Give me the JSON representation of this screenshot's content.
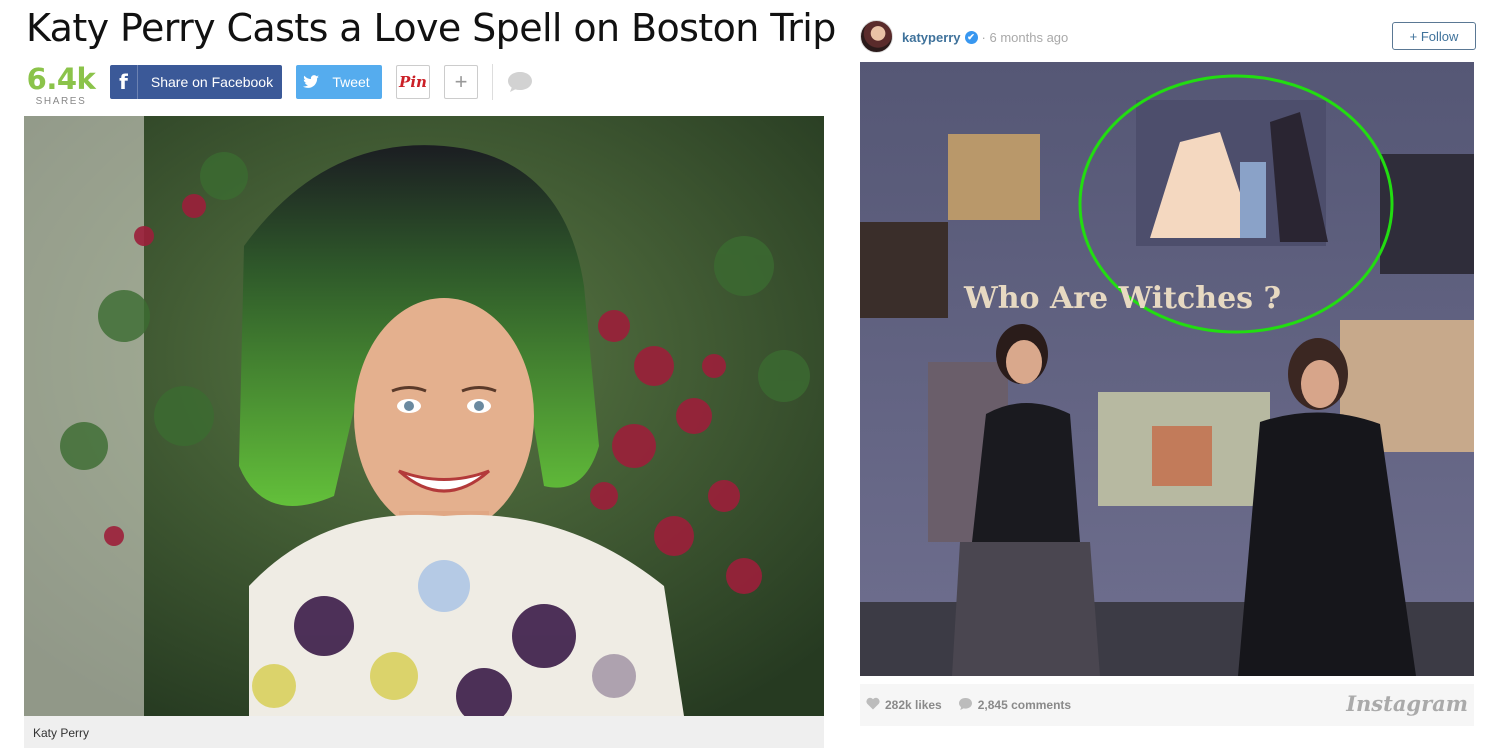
{
  "article": {
    "headline": "Katy Perry Casts a Love Spell on Boston Trip",
    "shares_count": "6.4k",
    "shares_label": "SHARES",
    "share_buttons": {
      "facebook_icon": "f",
      "facebook_label": "Share on Facebook",
      "twitter_label": "Tweet",
      "pinterest_label": "Pin",
      "more_label": "+"
    },
    "hero_caption": "Katy Perry"
  },
  "instagram": {
    "username": "katyperry",
    "verified_mark": "✔",
    "time": "· 6 months ago",
    "follow_label": "+ Follow",
    "photo_sign_text": "Who Are Witches ?",
    "likes": "282k likes",
    "comments": "2,845 comments",
    "logo": "Instagram"
  },
  "colors": {
    "facebook": "#3b5998",
    "twitter": "#55acee",
    "pinterest": "#cb2027",
    "shares_green": "#8bc34a",
    "instagram_link": "#3f729b",
    "highlight_circle": "#22dd11"
  },
  "icons": [
    "facebook-icon",
    "twitter-bird-icon",
    "pinterest-icon",
    "plus-icon",
    "comment-bubble-icon",
    "verified-badge-icon",
    "heart-icon",
    "comment-icon"
  ]
}
